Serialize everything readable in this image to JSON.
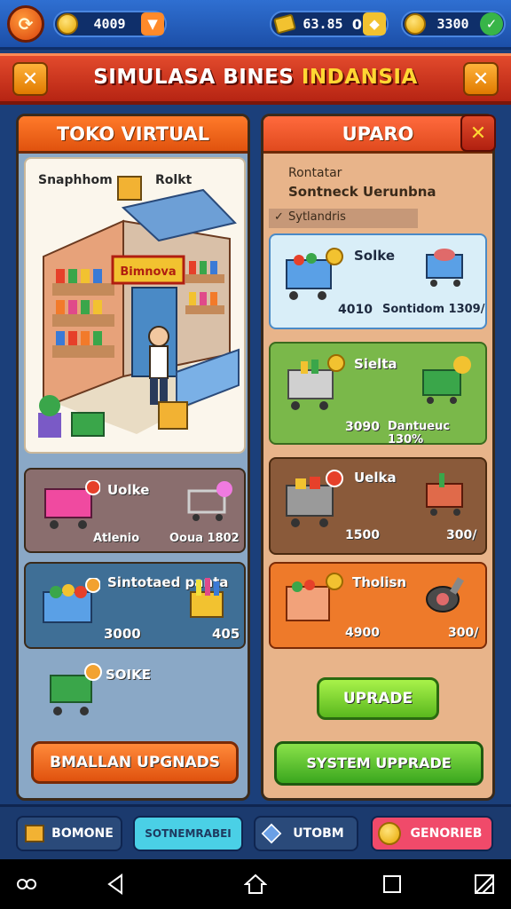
{
  "topbar": {
    "res1": {
      "value": "4009",
      "plus_icon": "arrow-down-icon"
    },
    "res2": {
      "value": "63.85",
      "extra": "0",
      "plus_icon": "diamond-icon"
    },
    "res3": {
      "value": "3300",
      "plus_icon": "check-icon"
    }
  },
  "title": {
    "main": "SIMULASA BINES ",
    "accent": "INDANSIA"
  },
  "left_panel": {
    "header": "TOKO VIRTUAL",
    "store_labels": {
      "left": "Snaphhom",
      "right": "Rolkt",
      "sign": "Bimnova"
    },
    "cards": [
      {
        "title": "Uolke",
        "left": "Atlenio",
        "right": "Ooua 1802"
      },
      {
        "title": "Sintotaed panta",
        "left": "3000",
        "right": "405"
      },
      {
        "title": "SOIKE"
      }
    ],
    "button": "BMALLAN UPGNADS"
  },
  "right_panel": {
    "header": "UPARO",
    "info": {
      "line1": "Rontatar",
      "line2": "Sontneck Uerunbna",
      "check": "Sytlandris"
    },
    "cards": [
      {
        "title": "Solke",
        "left": "4010",
        "right": "Sontidom 1309/"
      },
      {
        "title": "Sielta",
        "left": "3090",
        "right": "Dantueuc 130%"
      },
      {
        "title": "Uelka",
        "left": "1500",
        "right": "300/"
      },
      {
        "title": "Tholisn",
        "left": "4900",
        "right": "300/"
      }
    ],
    "upgrade_button": "UPRADE",
    "system_button": "SYSTEM UPPRADE"
  },
  "bottom_nav": [
    {
      "label": "BOMONE",
      "icon": "box-icon"
    },
    {
      "label": "SOTNEMRABEI",
      "icon": ""
    },
    {
      "label": "UTOBM",
      "icon": "cube-icon"
    },
    {
      "label": "GENORIEB",
      "icon": "coin-icon"
    }
  ]
}
